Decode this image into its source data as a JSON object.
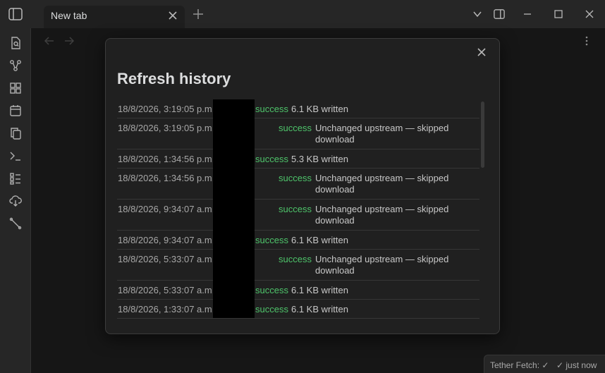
{
  "tab": {
    "label": "New tab"
  },
  "modal": {
    "title": "Refresh history",
    "rows": [
      {
        "timestamp": "18/8/2026, 3:19:05 p.m.",
        "status": "success",
        "message": "6.1 KB written",
        "layout": "single"
      },
      {
        "timestamp": "18/8/2026, 3:19:05 p.m.",
        "status": "success",
        "message": "Unchanged upstream — skipped download",
        "layout": "double"
      },
      {
        "timestamp": "18/8/2026, 1:34:56 p.m.",
        "status": "success",
        "message": "5.3 KB written",
        "layout": "single"
      },
      {
        "timestamp": "18/8/2026, 1:34:56 p.m.",
        "status": "success",
        "message": "Unchanged upstream — skipped download",
        "layout": "double"
      },
      {
        "timestamp": "18/8/2026, 9:34:07 a.m.",
        "status": "success",
        "message": "Unchanged upstream — skipped download",
        "layout": "double"
      },
      {
        "timestamp": "18/8/2026, 9:34:07 a.m.",
        "status": "success",
        "message": "6.1 KB written",
        "layout": "single"
      },
      {
        "timestamp": "18/8/2026, 5:33:07 a.m.",
        "status": "success",
        "message": "Unchanged upstream — skipped download",
        "layout": "double"
      },
      {
        "timestamp": "18/8/2026, 5:33:07 a.m.",
        "status": "success",
        "message": "6.1 KB written",
        "layout": "single"
      },
      {
        "timestamp": "18/8/2026, 1:33:07 a.m.",
        "status": "success",
        "message": "6.1 KB written",
        "layout": "single"
      }
    ]
  },
  "statusbar": {
    "fetch": "Tether Fetch: ✓",
    "time": "✓ just now"
  },
  "colors": {
    "success": "#4ec36a",
    "background": "#1e1e1e",
    "panel": "#262626"
  }
}
